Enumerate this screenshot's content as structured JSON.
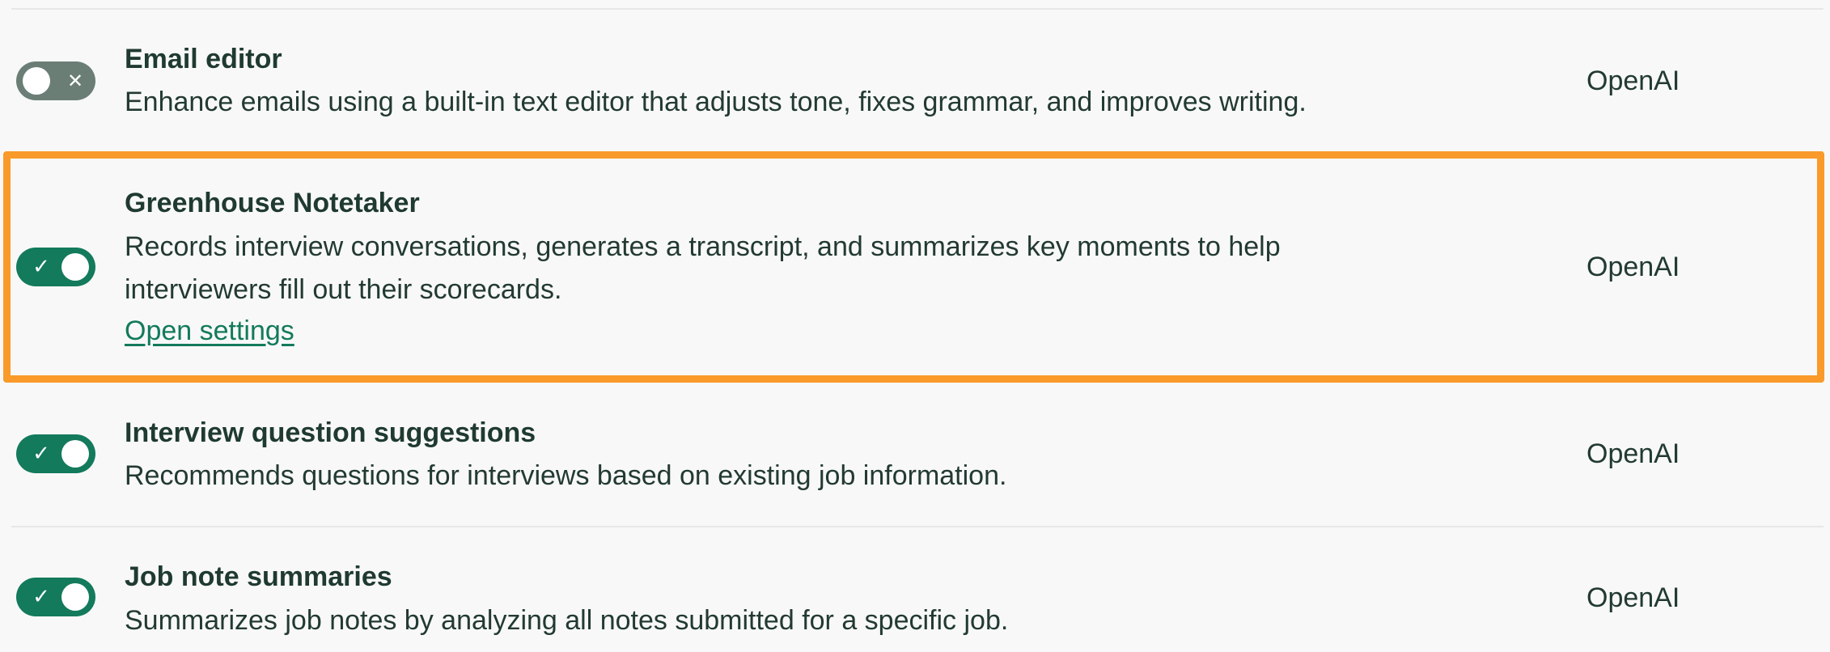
{
  "features": [
    {
      "title": "Email editor",
      "description_lines": [
        "Enhance emails using a built-in text editor that adjusts tone, fixes grammar, and improves writing."
      ],
      "provider": "OpenAI",
      "enabled": false,
      "toggle_glyph": "✕"
    },
    {
      "title": "Greenhouse Notetaker",
      "description_lines": [
        "Records interview conversations, generates a transcript, and summarizes key moments to help",
        "interviewers fill out their scorecards."
      ],
      "link_label": "Open settings",
      "provider": "OpenAI",
      "enabled": true,
      "toggle_glyph": "✓"
    },
    {
      "title": "Interview question suggestions",
      "description_lines": [
        "Recommends questions for interviews based on existing job information."
      ],
      "provider": "OpenAI",
      "enabled": true,
      "toggle_glyph": "✓"
    },
    {
      "title": "Job note summaries",
      "description_lines": [
        "Summarizes job notes by analyzing all notes submitted for a specific job."
      ],
      "provider": "OpenAI",
      "enabled": true,
      "toggle_glyph": "✓"
    }
  ],
  "colors": {
    "toggle_on": "#137a5b",
    "toggle_off": "#6b7e76",
    "highlight": "#f99a2a",
    "link": "#137a5b",
    "text": "#223a32"
  }
}
